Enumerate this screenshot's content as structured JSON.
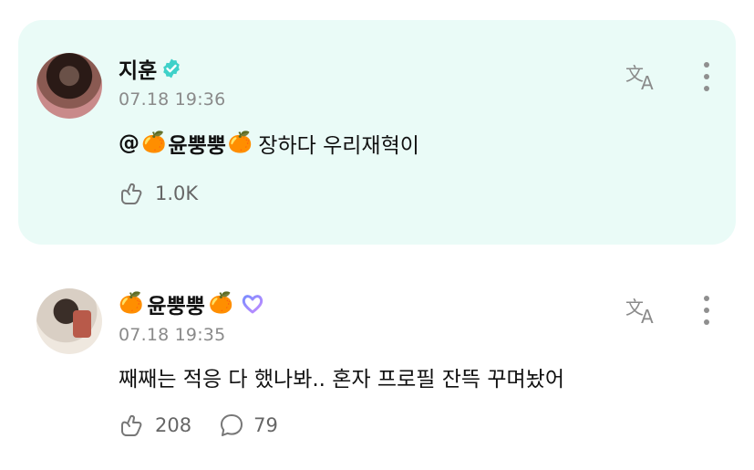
{
  "comments": [
    {
      "author": "지훈",
      "timestamp": "07.18 19:36",
      "mention_prefix": "@",
      "mention_name": "윤뿡뿡",
      "text": "장하다 우리재혁이",
      "likes": "1.0K",
      "highlighted": true
    },
    {
      "author": "윤뿡뿡",
      "timestamp": "07.18 19:35",
      "text": "째째는 적응 다 했나봐.. 혼자 프로필 잔뜩 꾸며놨어",
      "likes": "208",
      "replies": "79",
      "highlighted": false
    }
  ],
  "icons": {
    "orange_emoji": "🍊",
    "verified": "verified-badge-icon",
    "membership": "heart-membership-icon",
    "translate": "translate-icon",
    "more": "more-vertical-icon",
    "like": "like-hand-icon",
    "reply": "speech-bubble-icon"
  },
  "colors": {
    "highlight_bg": "#eafbf7",
    "verified": "#3fd1c9",
    "membership_gradient": [
      "#7b8cff",
      "#c48cff"
    ]
  }
}
